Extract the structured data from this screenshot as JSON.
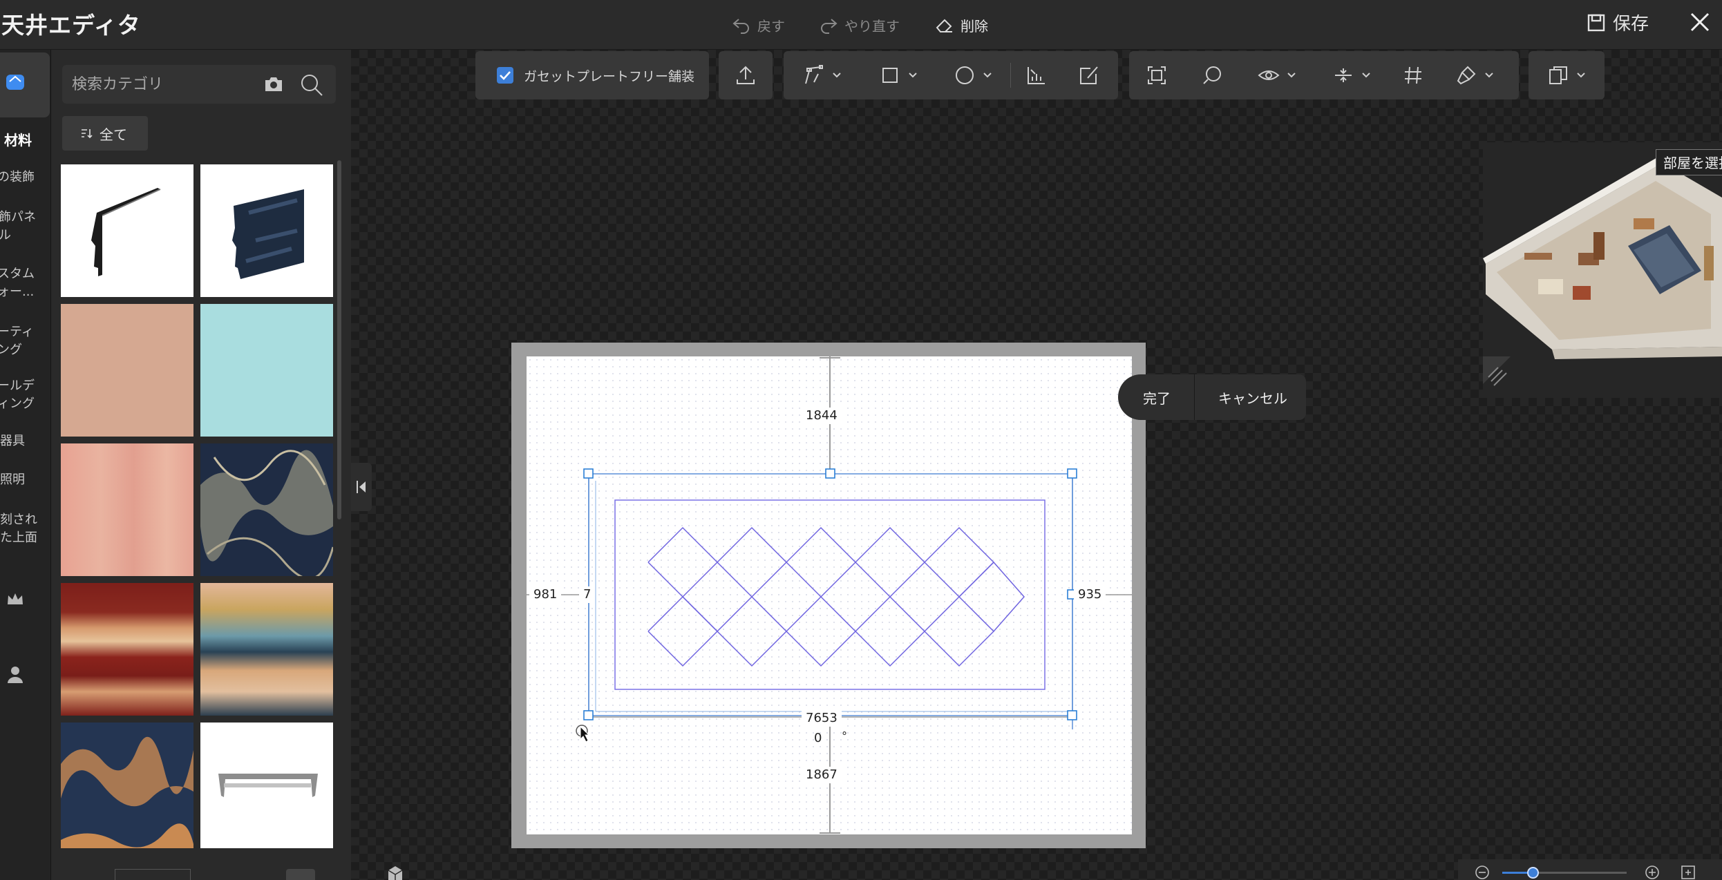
{
  "titlebar": {
    "title": "天井エディタ",
    "undo_label": "戻す",
    "redo_label": "やり直す",
    "delete_label": "削除",
    "save_label": "保存"
  },
  "rail": {
    "items": [
      {
        "label": "材料"
      },
      {
        "label": "の装飾"
      },
      {
        "label": "飾パネ\nル"
      },
      {
        "label": "スタム\nォー..."
      },
      {
        "label": "ーティ\nング"
      },
      {
        "label": "ールデ\nィング"
      },
      {
        "label": "器具"
      },
      {
        "label": "照明"
      },
      {
        "label": "刻され\nた上面"
      }
    ]
  },
  "panel": {
    "search_placeholder": "検索カテゴリ",
    "filter_label": "全て"
  },
  "toolbar": {
    "gusset_label": "ガセットプレートフリー舗装",
    "gusset_checked": true
  },
  "canvas": {
    "dim_top": "1844",
    "dim_left": "981",
    "dim_left_inner": "7",
    "dim_right": "935",
    "dim_width": "7653",
    "angle": "0",
    "angle_unit": "°",
    "dim_bottom": "1867"
  },
  "confirm": {
    "done_label": "完了",
    "cancel_label": "キャンセル"
  },
  "preview": {
    "room_select_label": "部屋を選択"
  },
  "colors": {
    "accent": "#3d7fd8",
    "pattern_stroke": "#6f64e0",
    "selection": "#2b7fd6"
  }
}
